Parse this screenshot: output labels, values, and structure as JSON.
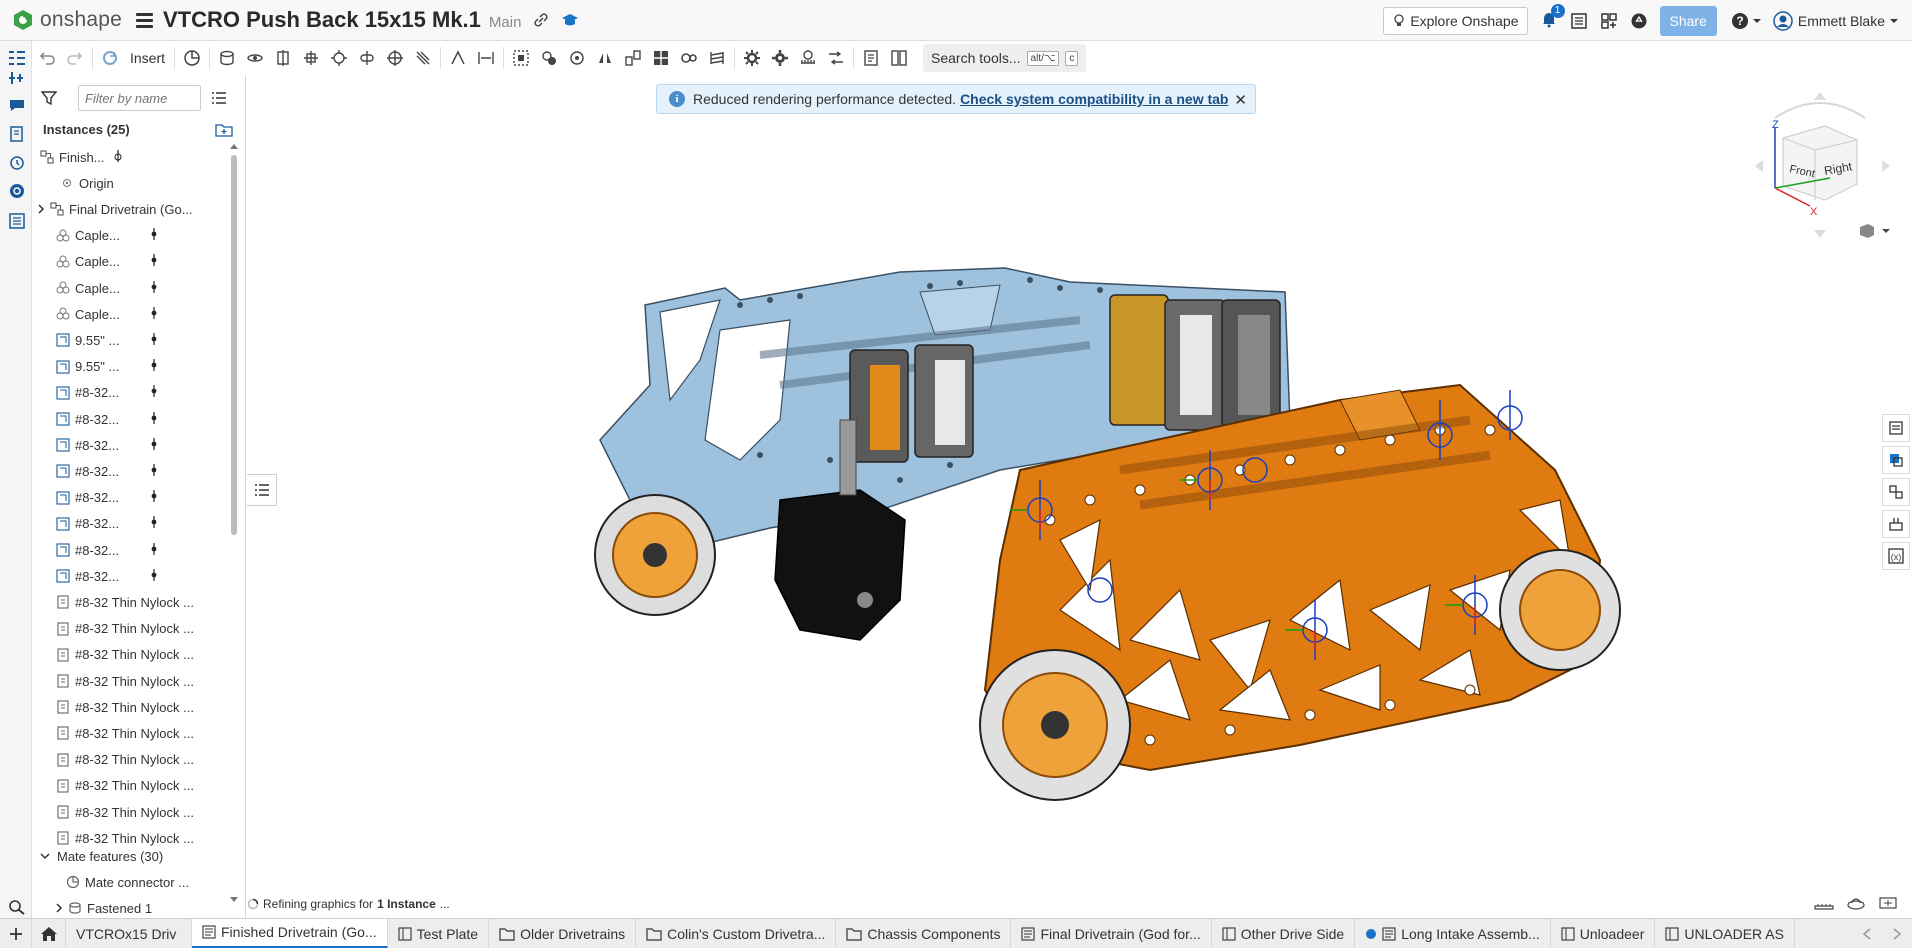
{
  "app": {
    "name": "onshape"
  },
  "document": {
    "title": "VTCRO Push Back 15x15 Mk.1",
    "branch": "Main"
  },
  "top_right": {
    "explore": "Explore Onshape",
    "notifications": "1",
    "share": "Share",
    "user": "Emmett Blake"
  },
  "toolbar": {
    "insert": "Insert",
    "search": "Search tools...",
    "kbd1": "alt/⌥",
    "kbd2": "c"
  },
  "instances": {
    "filter_placeholder": "Filter by name",
    "header": "Instances (25)",
    "items": [
      {
        "label": "Finish...",
        "kind": "assembly"
      },
      {
        "label": "Origin",
        "kind": "origin"
      },
      {
        "label": "Final Drivetrain (Go...",
        "kind": "subassembly"
      },
      {
        "label": "Caple...",
        "kind": "part"
      },
      {
        "label": "Caple...",
        "kind": "part"
      },
      {
        "label": "Caple...",
        "kind": "part"
      },
      {
        "label": "Caple...",
        "kind": "part"
      },
      {
        "label": "9.55\" ...",
        "kind": "studio"
      },
      {
        "label": "9.55\" ...",
        "kind": "studio"
      },
      {
        "label": "#8-32...",
        "kind": "studio"
      },
      {
        "label": "#8-32...",
        "kind": "studio"
      },
      {
        "label": "#8-32...",
        "kind": "studio"
      },
      {
        "label": "#8-32...",
        "kind": "studio"
      },
      {
        "label": "#8-32...",
        "kind": "studio"
      },
      {
        "label": "#8-32...",
        "kind": "studio"
      },
      {
        "label": "#8-32...",
        "kind": "studio"
      },
      {
        "label": "#8-32...",
        "kind": "studio"
      },
      {
        "label": "#8-32 Thin Nylock ...",
        "kind": "hw"
      },
      {
        "label": "#8-32 Thin Nylock ...",
        "kind": "hw"
      },
      {
        "label": "#8-32 Thin Nylock ...",
        "kind": "hw"
      },
      {
        "label": "#8-32 Thin Nylock ...",
        "kind": "hw"
      },
      {
        "label": "#8-32 Thin Nylock ...",
        "kind": "hw"
      },
      {
        "label": "#8-32 Thin Nylock ...",
        "kind": "hw"
      },
      {
        "label": "#8-32 Thin Nylock ...",
        "kind": "hw"
      },
      {
        "label": "#8-32 Thin Nylock ...",
        "kind": "hw"
      },
      {
        "label": "#8-32 Thin Nylock ...",
        "kind": "hw"
      },
      {
        "label": "#8-32 Thin Nylock ...",
        "kind": "hw"
      }
    ],
    "mate_header": "Mate features (30)",
    "mate_items": [
      "Mate connector ...",
      "Fastened 1"
    ]
  },
  "banner": {
    "text": "Reduced rendering performance detected.",
    "link": "Check system compatibility in a new tab"
  },
  "view_cube": {
    "top": "Z",
    "front": "Front",
    "right": "Right",
    "x": "X"
  },
  "status": {
    "prefix": "Refining graphics for",
    "bold": "1 Instance",
    "suffix": "..."
  },
  "tabs": [
    {
      "label": "VTCROx15 Driv",
      "kind": "doc"
    },
    {
      "label": "Finished Drivetrain (Go...",
      "kind": "assembly",
      "active": true
    },
    {
      "label": "Test Plate",
      "kind": "partstudio"
    },
    {
      "label": "Older Drivetrains",
      "kind": "folder"
    },
    {
      "label": "Colin's Custom Drivetra...",
      "kind": "folder"
    },
    {
      "label": "Chassis Components",
      "kind": "folder"
    },
    {
      "label": "Final Drivetrain (God for...",
      "kind": "assembly"
    },
    {
      "label": "Other Drive Side",
      "kind": "partstudio"
    },
    {
      "label": "Long Intake Assemb...",
      "kind": "assembly"
    },
    {
      "label": "Unloadeer",
      "kind": "partstudio"
    },
    {
      "label": "UNLOADER AS",
      "kind": "partstudio"
    }
  ],
  "colors": {
    "orange": "#e07b12",
    "blue": "#9ec1de",
    "accent": "#1a73c6",
    "share": "#7fb2e6"
  }
}
